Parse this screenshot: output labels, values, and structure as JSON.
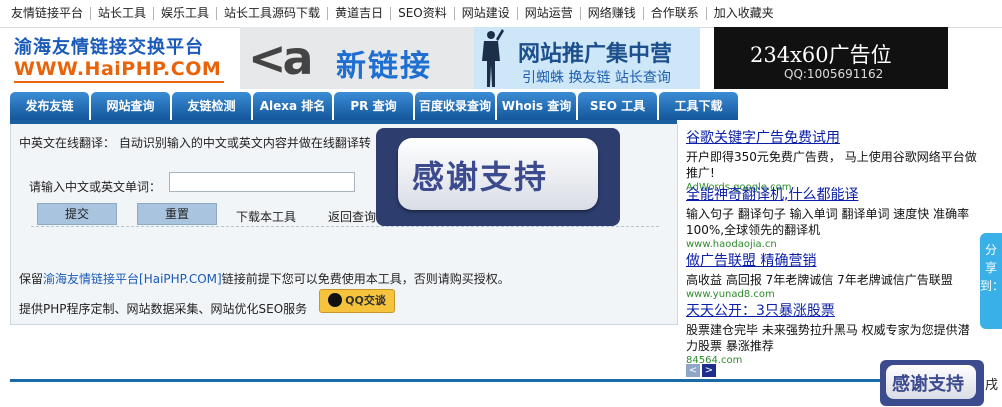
{
  "topnav": {
    "items": [
      "友情链接平台",
      "站长工具",
      "娱乐工具",
      "站长工具源码下载",
      "黄道吉日",
      "SEO资料",
      "网站建设",
      "网站运营",
      "网络赚钱",
      "合作联系",
      "加入收藏夹"
    ]
  },
  "logo": {
    "line1": "渝海友情链接交换平台",
    "line2": "WWW.HaiPHP.COM"
  },
  "banner_ads": {
    "xinlianjie": {
      "mark": "<a",
      "title": "新链接"
    },
    "tuiguang": {
      "title": "网站推广集中营",
      "subtitle": "引蜘蛛 换友链 站长查询"
    },
    "slot": {
      "title": "234x60广告位",
      "qq": "QQ:1005691162"
    }
  },
  "tabs": [
    "发布友链",
    "网站查询",
    "友链检测",
    "Alexa 排名",
    "PR 查询",
    "百度收录查询",
    "Whois 查询",
    "SEO 工具",
    "工具下载"
  ],
  "translator": {
    "intro": "中英文在线翻译：  自动识别输入的中文或英文内容并做在线翻译转",
    "label": "请输入中文或英文单词：",
    "input_value": "",
    "submit": "提交",
    "reset": "重置",
    "download": "下载本工具",
    "back": "返回查询"
  },
  "notice": {
    "prefix": "保留",
    "link": "渝海友情链接平台[HaiPHP.COM]",
    "suffix": "链接前提下您可以免费使用本工具，否则请购买授权。"
  },
  "service": {
    "text": "提供PHP程序定制、网站数据采集、网站优化SEO服务",
    "qq_button": "QQ交谈"
  },
  "thanks_popup": "感谢支持",
  "thanks_corner": "感谢支持",
  "bottom_tail": "戌",
  "right_ads": [
    {
      "title": "谷歌关键字广告免费试用",
      "desc": "开户即得350元免费广告费， 马上使用谷歌网络平台做推广!",
      "url": "AdWords.google.com"
    },
    {
      "title": "全能神奇翻译机,什么都能译",
      "desc": "输入句子 翻译句子 输入单词 翻译单词  速度快 准确率100%,全球领先的翻译机",
      "url": "www.haodaojia.cn"
    },
    {
      "title": "做广告联盟  精确营销",
      "desc": "高收益  高回报  7年老牌诚信  7年老牌诚信广告联盟",
      "url": "www.yunad8.com"
    },
    {
      "title": "天天公开：3只暴涨股票",
      "desc": "股票建仓完毕 未来强势拉升黑马  权威专家为您提供潜力股票 暴涨推荐",
      "url": "84564.com"
    }
  ],
  "pager": {
    "prev": "<",
    "next": ">"
  },
  "share": "分享到：",
  "colors": {
    "tab_blue": "#1a5f9e",
    "ad_link": "#0b1fa8",
    "ad_url": "#2f8a2f",
    "brand_orange": "#e8630a"
  }
}
